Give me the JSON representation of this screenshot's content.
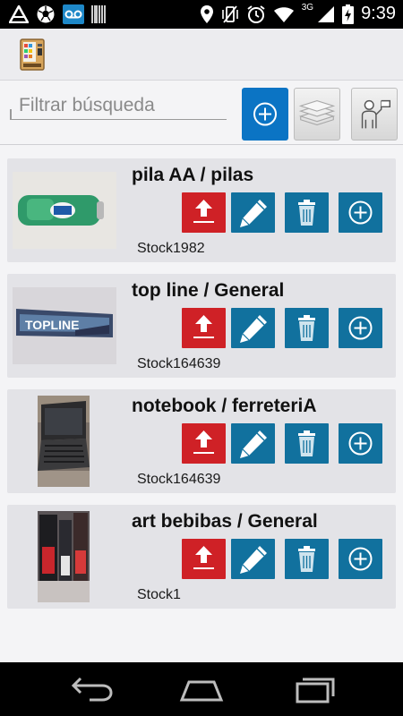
{
  "status_bar": {
    "time": "9:39",
    "network": "3G",
    "left_icons": [
      "app-notification-icon",
      "soccer-ball-icon",
      "voicemail-icon",
      "barcode-icon"
    ],
    "right_icons": [
      "location-pin-icon",
      "vibrate-off-icon",
      "alarm-icon",
      "wifi-icon",
      "signal-icon",
      "battery-charging-icon"
    ]
  },
  "search": {
    "placeholder": "Filtrar búsqueda",
    "value": ""
  },
  "toolbar": {
    "add_icon": "plus-circle-icon",
    "layers_icon": "layers-icon",
    "person_icon": "person-flag-icon"
  },
  "items": [
    {
      "title": "pila AA / pilas",
      "stock": "Stock1982",
      "photo": "bic-battery"
    },
    {
      "title": "top line / General",
      "stock": "Stock164639",
      "photo": "topline-gum"
    },
    {
      "title": "notebook / ferreteriA",
      "stock": "Stock164639",
      "photo": "laptop"
    },
    {
      "title": "art bebibas / General",
      "stock": "Stock1",
      "photo": "drinks"
    }
  ],
  "colors": {
    "primary_blue": "#0b74c4",
    "action_blue": "#11719e",
    "upload_red": "#cf2126",
    "card_bg": "#e3e3e7",
    "page_bg": "#f4f4f6"
  },
  "nav_bar": {
    "icons": [
      "back-icon",
      "home-icon",
      "recent-apps-icon"
    ]
  }
}
